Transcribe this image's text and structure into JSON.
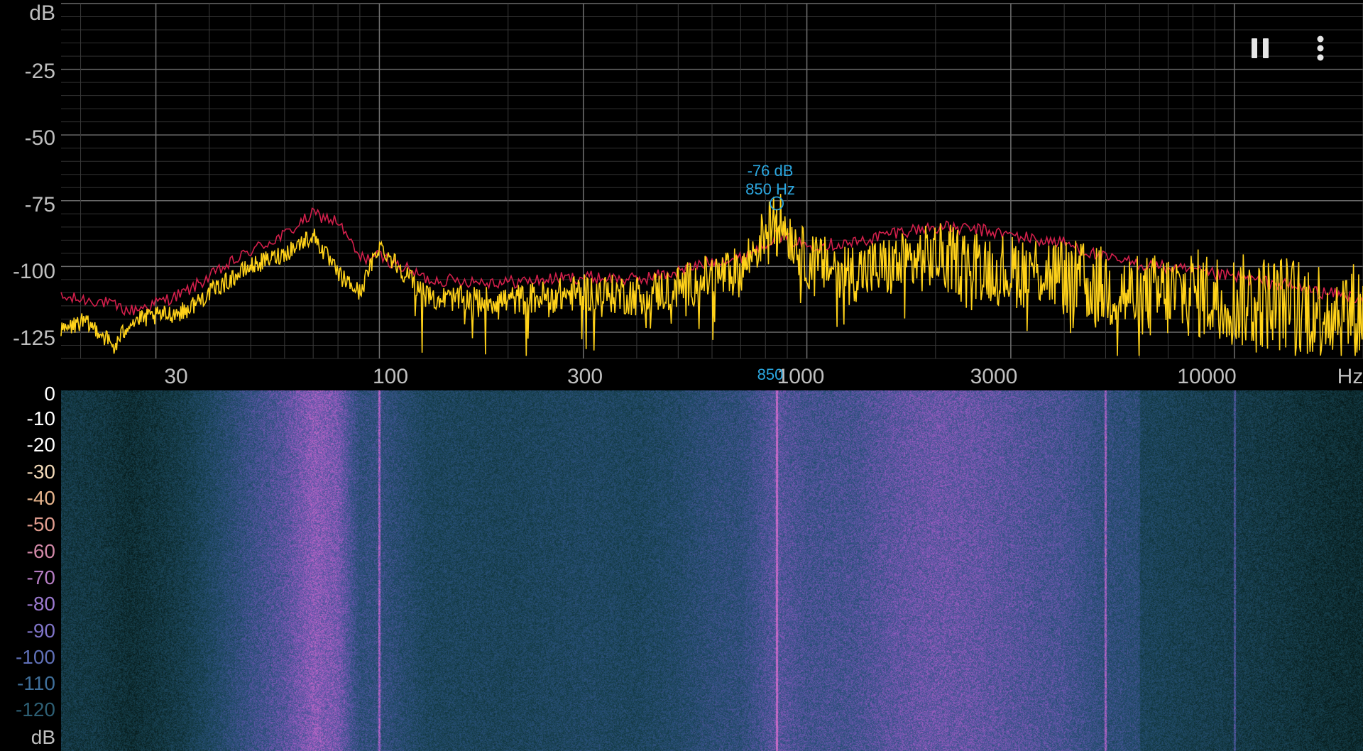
{
  "spectrum": {
    "y_unit": "dB",
    "y_ticks": [
      "-25",
      "-50",
      "-75",
      "-100",
      "-125"
    ],
    "x_unit": "Hz",
    "x_ticks": [
      "30",
      "100",
      "300",
      "1000",
      "3000",
      "10000"
    ]
  },
  "peak_marker": {
    "level_label": "-76 dB",
    "freq_label": "850 Hz",
    "axis_label": "850",
    "freq_hz": 850,
    "level_db": -76
  },
  "spectrogram": {
    "scale_labels": [
      "0",
      "-10",
      "-20",
      "-30",
      "-40",
      "-50",
      "-60",
      "-70",
      "-80",
      "-90",
      "-100",
      "-110",
      "-120"
    ],
    "unit": "dB",
    "scale_colors": [
      "#ffffff",
      "#ffffff",
      "#ffffff",
      "#f2d9b8",
      "#e6b48c",
      "#df9c8e",
      "#d087a6",
      "#b47cc2",
      "#9a79cf",
      "#7f74c8",
      "#5f6fb6",
      "#3f6f9a",
      "#2d5e73"
    ]
  },
  "toolbar": {
    "pause_icon": "pause-icon",
    "menu_icon": "more-vertical-icon"
  },
  "colors": {
    "peak_hold_trace": "#d21f4b",
    "live_trace": "#ffd21a",
    "marker": "#2ba7e0",
    "grid": "#5a5a5a",
    "background": "#000000"
  },
  "chart_data": {
    "type": "line",
    "x_scale": "log",
    "xlim": [
      18,
      20000
    ],
    "ylim": [
      -135,
      0
    ],
    "xlabel": "Hz",
    "ylabel": "dB",
    "series": [
      {
        "x": [
          18,
          22,
          26,
          30,
          35,
          40,
          50,
          60,
          70,
          80,
          90,
          100,
          130,
          200,
          300,
          400,
          500,
          600,
          700,
          850,
          1000,
          1300,
          1600,
          2000,
          2500,
          3000,
          3500,
          4000,
          5000,
          6000,
          8000,
          10000,
          13000,
          16000,
          20000
        ],
        "y": [
          -112,
          -113,
          -117,
          -114,
          -110,
          -104,
          -94,
          -88,
          -80,
          -83,
          -97,
          -96,
          -105,
          -106,
          -104,
          -105,
          -102,
          -98,
          -97,
          -88,
          -92,
          -91,
          -87,
          -85,
          -86,
          -88,
          -90,
          -91,
          -97,
          -99,
          -102,
          -104,
          -107,
          -110,
          -112
        ]
      },
      {
        "x": [
          18,
          20,
          22,
          24,
          26,
          30,
          35,
          40,
          50,
          60,
          70,
          80,
          90,
          100,
          130,
          200,
          300,
          400,
          500,
          600,
          700,
          850,
          1000,
          1300,
          1600,
          2000,
          2500,
          3000,
          3500,
          4000,
          5000,
          6000,
          8000,
          10000,
          13000,
          16000,
          20000
        ],
        "y": [
          -125,
          -121,
          -124,
          -131,
          -121,
          -119,
          -117,
          -110,
          -100,
          -95,
          -88,
          -103,
          -110,
          -92,
          -112,
          -113,
          -110,
          -111,
          -108,
          -104,
          -102,
          -80,
          -98,
          -102,
          -100,
          -96,
          -99,
          -102,
          -101,
          -104,
          -108,
          -112,
          -110,
          -113,
          -114,
          -116,
          -118
        ]
      }
    ]
  }
}
